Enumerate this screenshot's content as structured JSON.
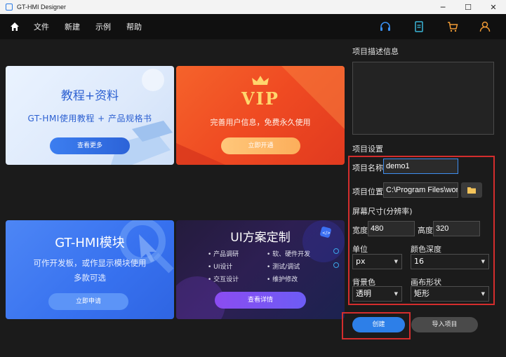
{
  "window": {
    "title": "GT-HMI Designer",
    "controls": [
      "─",
      "☐",
      "✕"
    ]
  },
  "menu": {
    "items": [
      "文件",
      "新建",
      "示例",
      "帮助"
    ],
    "icons": [
      "home-icon",
      "headset-icon",
      "document-icon",
      "cart-icon",
      "user-icon"
    ]
  },
  "cards": {
    "tutorial": {
      "title": "教程+资料",
      "subtitle": "GT-HMI使用教程 + 产品规格书",
      "button": "查看更多"
    },
    "vip": {
      "logo": "VIP",
      "subtitle": "完善用户信息，免费永久使用",
      "button": "立即开通"
    },
    "module": {
      "title": "GT-HMI模块",
      "subtitle_line1": "可作开发板，或作显示模块使用",
      "subtitle_line2": "多款可选",
      "button": "立即申请"
    },
    "custom": {
      "title": "UI方案定制",
      "features": [
        "• 产品调研",
        "• 软、硬件开发",
        "• UI设计",
        "• 测试/调试",
        "• 交互设计",
        "• 维护修改"
      ],
      "button": "查看详情"
    }
  },
  "panel": {
    "desc_label": "项目描述信息",
    "settings_label": "项目设置",
    "name_label": "项目名称",
    "name_value": "demo1",
    "location_label": "项目位置",
    "location_value": "C:\\Program Files\\wor",
    "resolution_label": "屏幕尺寸(分辨率)",
    "width_label": "宽度",
    "width_value": "480",
    "height_label": "高度",
    "height_value": "320",
    "unit_label": "单位",
    "unit_value": "px",
    "depth_label": "颜色深度",
    "depth_value": "16",
    "bg_label": "背景色",
    "bg_value": "透明",
    "shape_label": "画布形状",
    "shape_value": "矩形",
    "create_button": "创建",
    "import_button": "导入项目"
  },
  "colors": {
    "accent": "#2d7fe8",
    "highlight": "#d42d2d"
  }
}
